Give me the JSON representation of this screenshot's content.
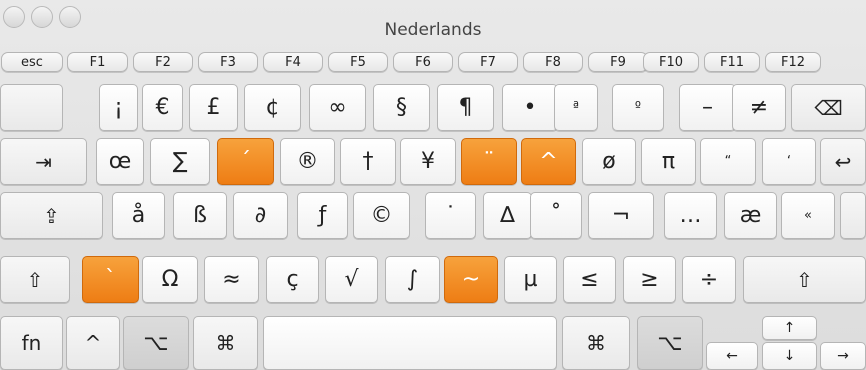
{
  "window": {
    "title": "Nederlands"
  },
  "function_row": [
    "esc",
    "F1",
    "F2",
    "F3",
    "F4",
    "F5",
    "F6",
    "F7",
    "F8",
    "F9",
    "F10",
    "F11",
    "F12"
  ],
  "rows": {
    "number": [
      "¡",
      "€",
      "£",
      "¢",
      "∞",
      "§",
      "¶",
      "•",
      "ª",
      "º",
      "–",
      "≠",
      "⌫"
    ],
    "top": [
      "⇥",
      "œ",
      "∑",
      "´",
      "®",
      "†",
      "¥",
      "¨",
      "^",
      "ø",
      "π",
      "“",
      "‘",
      "↩"
    ],
    "home": [
      "⇪",
      "å",
      "ß",
      "∂",
      "ƒ",
      "©",
      "˙",
      "∆",
      "˚",
      "¬",
      "…",
      "æ",
      "«"
    ],
    "bottom": [
      "⇧",
      "`",
      "Ω",
      "≈",
      "ç",
      "√",
      "∫",
      "~",
      "µ",
      "≤",
      "≥",
      "÷",
      "⇧"
    ],
    "space": [
      "fn",
      "^",
      "⌥",
      "⌘",
      "⌘",
      "⌥",
      "←",
      "↑",
      "↓",
      "→"
    ]
  },
  "colors": {
    "dead_key": "#f08a1f",
    "key_bg": "#ffffff",
    "window_bg": "#e2e2e2"
  }
}
